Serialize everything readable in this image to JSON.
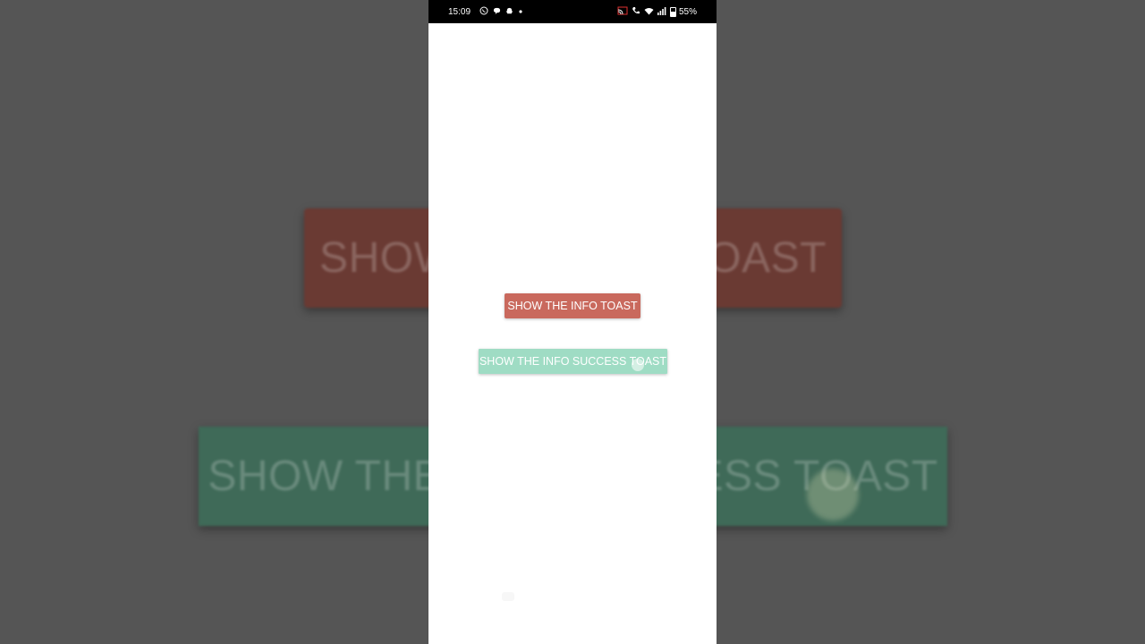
{
  "status_bar": {
    "time": "15:09",
    "left_icons": [
      "whatsapp-icon",
      "chat-bubble-icon",
      "snapchat-icon",
      "dot-icon"
    ],
    "right_icons": [
      "cast-icon",
      "wifi-call-icon",
      "wifi-icon",
      "signal-icon",
      "battery-icon"
    ],
    "battery": "55%"
  },
  "buttons": {
    "info_toast": "SHOW THE INFO TOAST",
    "success_toast": "SHOW THE INFO SUCCESS TOAST"
  },
  "colors": {
    "info_button": "#c9695d",
    "success_button": "#9fdcc4",
    "backdrop": "#555555"
  }
}
